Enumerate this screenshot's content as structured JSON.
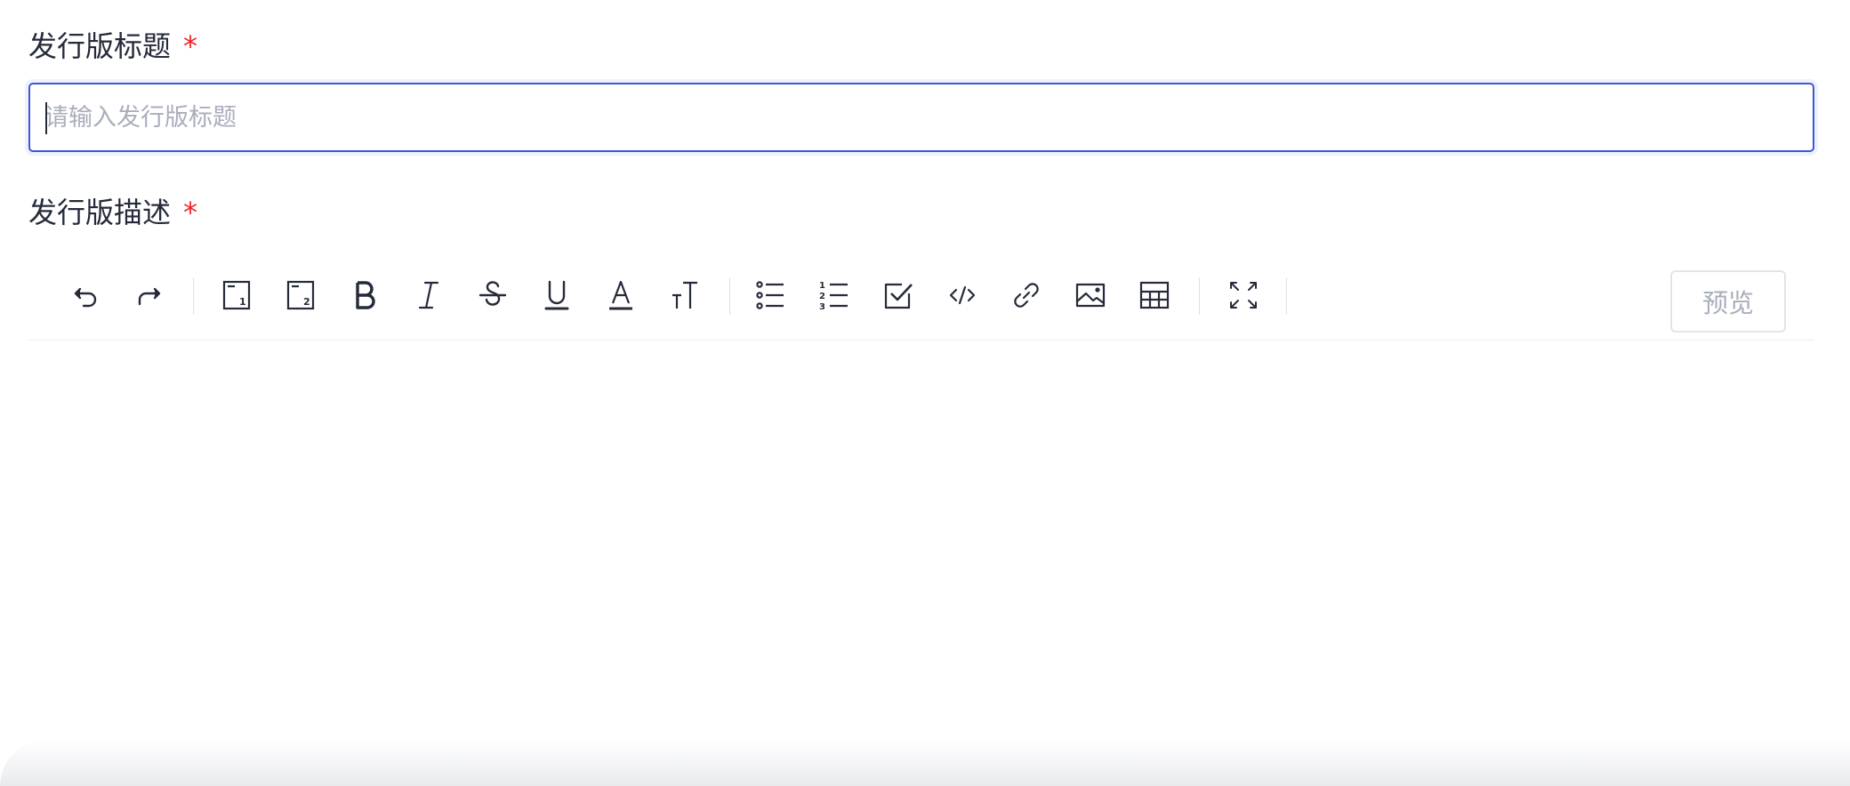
{
  "form": {
    "title_label": "发行版标题",
    "title_required_mark": "*",
    "title_placeholder": "请输入发行版标题",
    "title_value": "",
    "desc_label": "发行版描述",
    "desc_required_mark": "*"
  },
  "editor": {
    "toolbar_icons": [
      "undo-icon",
      "redo-icon",
      "heading-1-icon",
      "heading-2-icon",
      "bold-icon",
      "italic-icon",
      "strikethrough-icon",
      "underline-icon",
      "font-color-icon",
      "font-size-icon",
      "bulleted-list-icon",
      "numbered-list-icon",
      "task-list-icon",
      "code-icon",
      "link-icon",
      "image-icon",
      "table-icon",
      "fullscreen-icon"
    ],
    "preview_label": "预览",
    "content": ""
  },
  "colors": {
    "accent": "#3d57d6",
    "required": "#f2242a",
    "text": "#252b3a",
    "placeholder": "#a9aebd",
    "icon": "#252b3a"
  }
}
